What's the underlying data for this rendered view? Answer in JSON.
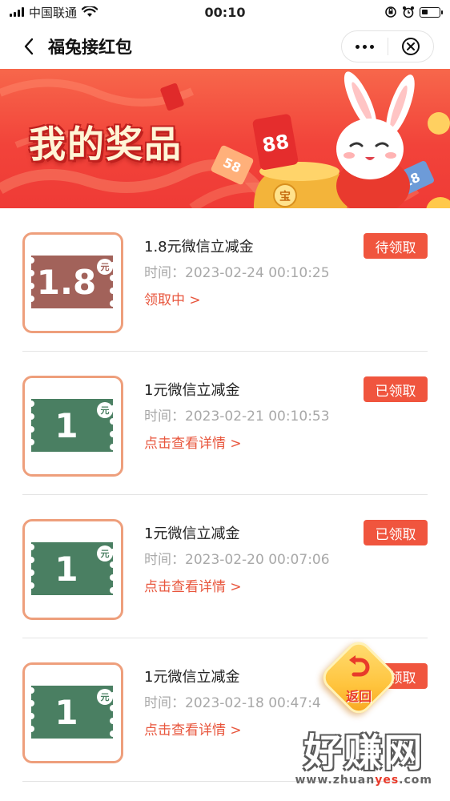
{
  "status_bar": {
    "carrier": "中国联通",
    "time": "00:10"
  },
  "nav": {
    "title": "福兔接红包"
  },
  "banner": {
    "title": "我的奖品",
    "ticket_left": "58",
    "ticket_right": "18",
    "bag_label": "88",
    "coin_label": "宝"
  },
  "prizes": [
    {
      "amount": "1.8",
      "unit": "元",
      "name": "1.8元微信立减金",
      "time": "时间：2023-02-24 00:10:25",
      "link": "领取中 >",
      "status": "待领取",
      "ticket_color": "#a2625a"
    },
    {
      "amount": "1",
      "unit": "元",
      "name": "1元微信立减金",
      "time": "时间：2023-02-21 00:10:53",
      "link": "点击查看详情 >",
      "status": "已领取",
      "ticket_color": "#4a7f62"
    },
    {
      "amount": "1",
      "unit": "元",
      "name": "1元微信立减金",
      "time": "时间：2023-02-20 00:07:06",
      "link": "点击查看详情 >",
      "status": "已领取",
      "ticket_color": "#4a7f62"
    },
    {
      "amount": "1",
      "unit": "元",
      "name": "1元微信立减金",
      "time": "时间：2023-02-18 00:47:4",
      "link": "点击查看详情 >",
      "status": "已领取",
      "ticket_color": "#4a7f62"
    }
  ],
  "fab": {
    "label": "返回"
  },
  "watermark": {
    "main": "好赚网",
    "url_prefix": "www.zhuan",
    "url_highlight": "yes",
    "url_suffix": ".com"
  },
  "colors": {
    "accent": "#f0553e",
    "link": "#e8563d",
    "thumb_border": "#ee9f7c"
  }
}
